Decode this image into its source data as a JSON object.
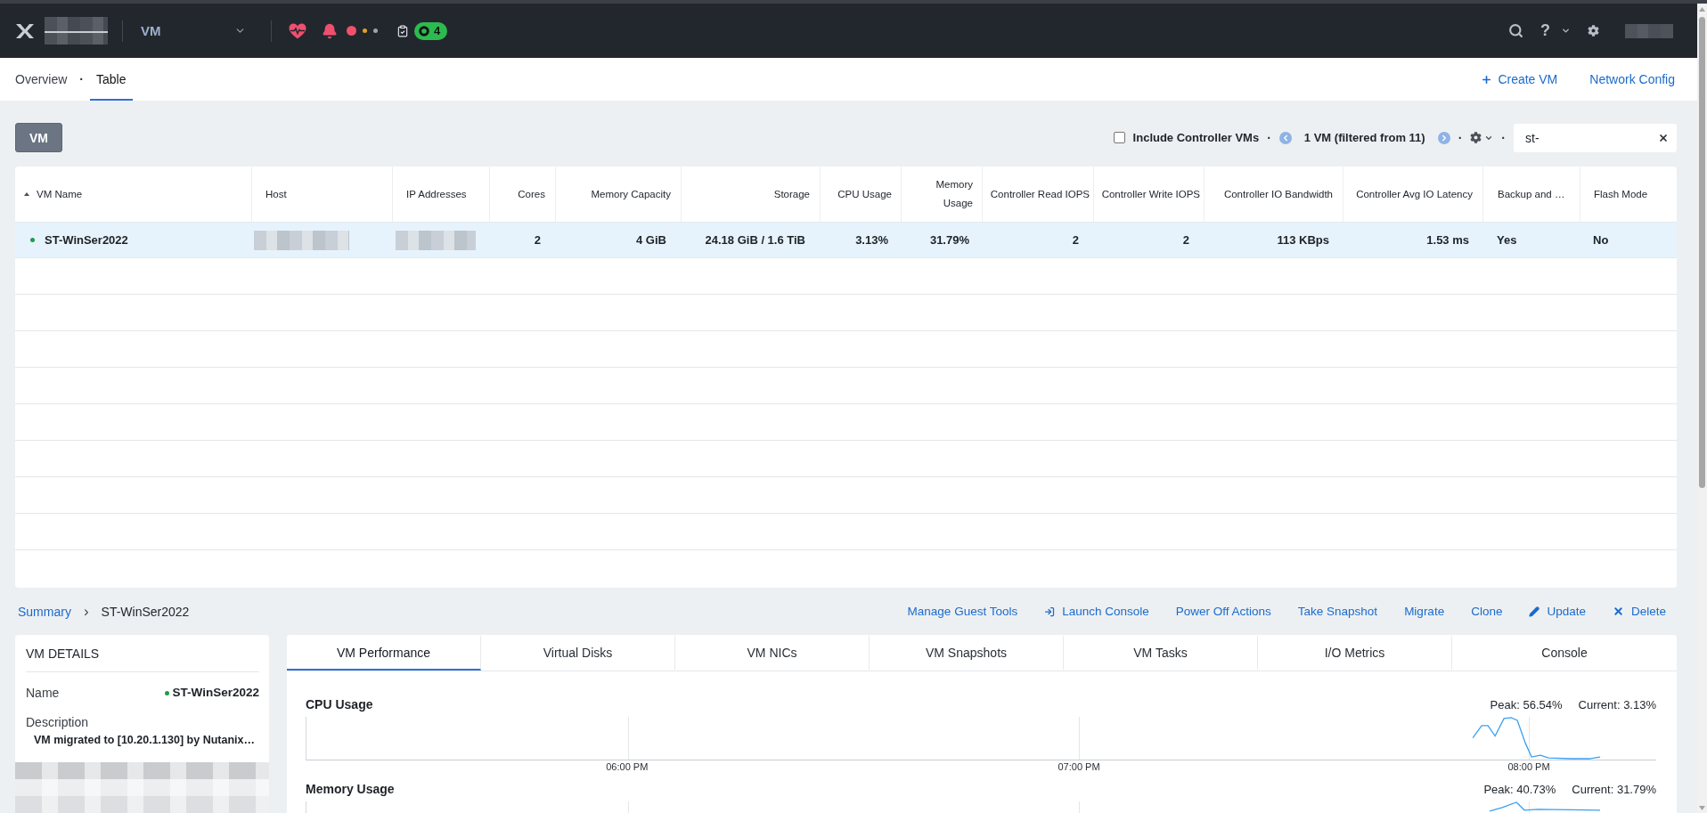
{
  "top_bar": {
    "app_selector": {
      "label": "VM"
    },
    "alerts": [
      {
        "color": "#f2506b",
        "active": true
      },
      {
        "color": "#e5a11c",
        "active": false
      },
      {
        "color": "#9aa4b1",
        "active": false
      }
    ],
    "tasks": {
      "count": "4"
    },
    "help": "?"
  },
  "nav": {
    "tabs": [
      {
        "label": "Overview",
        "selected": false
      },
      {
        "label": "Table",
        "selected": true
      }
    ],
    "separator": "·",
    "actions": [
      {
        "kind": "create",
        "label": "Create VM"
      },
      {
        "kind": "link",
        "label": "Network Config"
      }
    ]
  },
  "toolbar": {
    "entity_button": "VM",
    "items": [
      {
        "kind": "checkbox",
        "label": "Include Controller VMs",
        "checked": false
      },
      {
        "kind": "separator",
        "text": "·"
      },
      {
        "kind": "previous"
      },
      {
        "kind": "count",
        "text": "1 VM (filtered from 11)"
      },
      {
        "kind": "next"
      },
      {
        "kind": "separator",
        "text": "·"
      },
      {
        "kind": "settings"
      },
      {
        "kind": "separator",
        "text": "·"
      },
      {
        "kind": "search",
        "value": "st-"
      }
    ]
  },
  "table": {
    "columns": [
      {
        "label": "VM Name",
        "sorted": true
      },
      {
        "label": "Host",
        "sorted": false
      },
      {
        "label": "IP Addresses",
        "sorted": false
      },
      {
        "label": "Cores",
        "sorted": false
      },
      {
        "label": "Memory Capacity",
        "sorted": false
      },
      {
        "label": "Storage",
        "sorted": false
      },
      {
        "label": "CPU Usage",
        "sorted": false
      },
      {
        "label": "Memory Usage",
        "sorted": false
      },
      {
        "label": "Controller Read IOPS",
        "sorted": false
      },
      {
        "label": "Controller Write IOPS",
        "sorted": false
      },
      {
        "label": "Controller IO Bandwidth",
        "sorted": false
      },
      {
        "label": "Controller Avg IO Latency",
        "sorted": false
      },
      {
        "label": "Backup and …",
        "sorted": false
      },
      {
        "label": "Flash Mode",
        "sorted": false
      }
    ],
    "rows": [
      {
        "selected": true,
        "cells": [
          {
            "kind": "status",
            "text": "ST-WinSer2022",
            "color": "#1e9c48"
          },
          {
            "kind": "redacted"
          },
          {
            "kind": "redacted"
          },
          {
            "kind": "text",
            "text": "2"
          },
          {
            "kind": "text",
            "text": "4 GiB"
          },
          {
            "kind": "text",
            "text": "24.18 GiB / 1.6 TiB"
          },
          {
            "kind": "text",
            "text": "3.13%"
          },
          {
            "kind": "text",
            "text": "31.79%"
          },
          {
            "kind": "text",
            "text": "2"
          },
          {
            "kind": "text",
            "text": "2"
          },
          {
            "kind": "text",
            "text": "113 KBps"
          },
          {
            "kind": "text",
            "text": "1.53 ms"
          },
          {
            "kind": "text",
            "text": "Yes"
          },
          {
            "kind": "text",
            "text": "No"
          }
        ]
      }
    ]
  },
  "breadcrumb": {
    "root": "Summary",
    "separator": "›",
    "current": "ST-WinSer2022"
  },
  "actions": [
    {
      "kind": "link",
      "label": "Manage Guest Tools"
    },
    {
      "kind": "console",
      "label": "Launch Console"
    },
    {
      "kind": "link",
      "label": "Power Off Actions"
    },
    {
      "kind": "link",
      "label": "Take Snapshot"
    },
    {
      "kind": "link",
      "label": "Migrate"
    },
    {
      "kind": "link",
      "label": "Clone"
    },
    {
      "kind": "edit",
      "label": "Update"
    },
    {
      "kind": "delete",
      "label": "Delete"
    }
  ],
  "vm_details": {
    "title": "VM DETAILS",
    "fields": [
      {
        "kind": "inline",
        "label": "Name",
        "value": "ST-WinSer2022",
        "color": "#1e9c48"
      },
      {
        "kind": "stacked",
        "label": "Description",
        "value": "VM migrated to [10.20.1.130] by Nutanix…"
      }
    ]
  },
  "detail_tabs": [
    {
      "label": "VM Performance",
      "selected": true
    },
    {
      "label": "Virtual Disks",
      "selected": false
    },
    {
      "label": "VM NICs",
      "selected": false
    },
    {
      "label": "VM Snapshots",
      "selected": false
    },
    {
      "label": "VM Tasks",
      "selected": false
    },
    {
      "label": "I/O Metrics",
      "selected": false
    },
    {
      "label": "Console",
      "selected": false
    }
  ],
  "charts": [
    {
      "title": "CPU Usage",
      "peak": "Peak: 56.54%",
      "current": "Current: 3.13%",
      "x_labels": [
        "06:00 PM",
        "07:00 PM",
        "08:00 PM"
      ]
    },
    {
      "title": "Memory Usage",
      "peak": "Peak: 40.73%",
      "current": "Current: 31.79%"
    }
  ]
}
